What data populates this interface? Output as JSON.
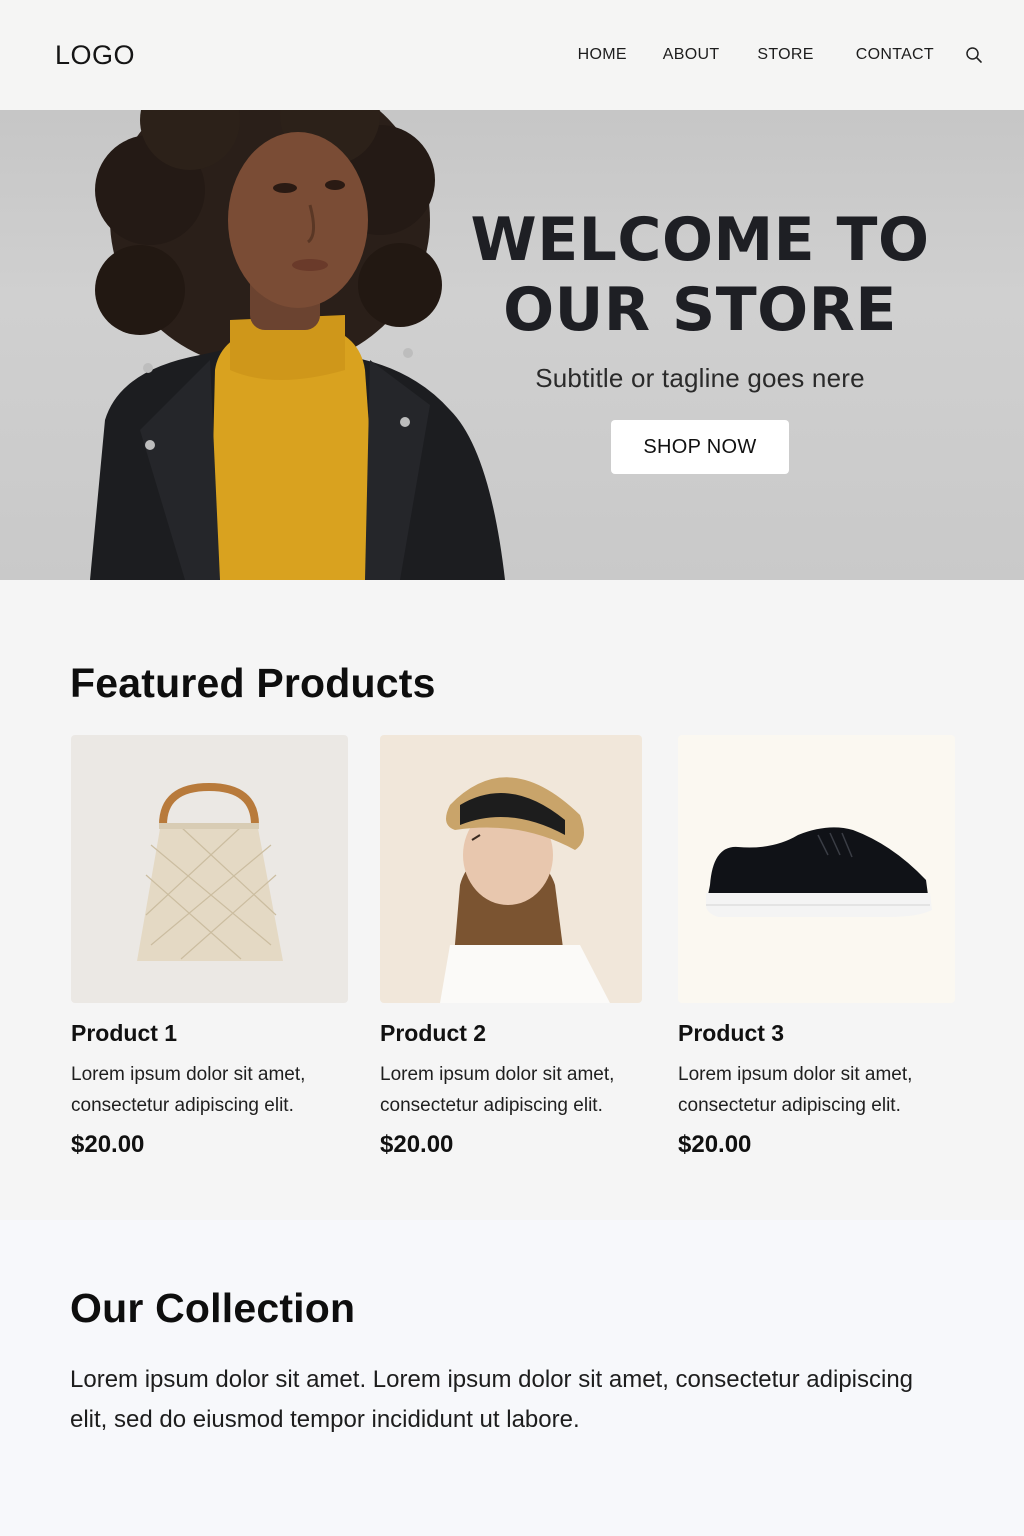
{
  "header": {
    "logo": "LOGO",
    "nav": {
      "home": "HOME",
      "about": "ABOUT",
      "store": "STORE",
      "contact": "CONTACT"
    },
    "search_icon": "search-icon"
  },
  "hero": {
    "title": "WELCOME TO\nOUR STORE",
    "subtitle": "Subtitle or tagline goes nere",
    "cta_label": "SHOP NOW"
  },
  "featured": {
    "title": "Featured Products",
    "products": [
      {
        "name": "Product 1",
        "description": "Lorem ipsum dolor sit amet, consectetur adipiscing elit.",
        "price": "$20.00",
        "image": "woven-handbag"
      },
      {
        "name": "Product 2",
        "description": "Lorem ipsum dolor sit amet, consectetur adipiscing elit.",
        "price": "$20.00",
        "image": "woman-in-straw-hat"
      },
      {
        "name": "Product 3",
        "description": "Lorem ipsum dolor sit amet, consectetur adipiscing elit.",
        "price": "$20.00",
        "image": "black-sneaker"
      }
    ]
  },
  "collection": {
    "title": "Our Collection",
    "text": "Lorem ipsum dolor sit amet.   Lorem ipsum dolor sit amet, consectetur adipiscing elit, sed do eiusmod tempor incididunt ut labore."
  },
  "colors": {
    "header_bg": "#f5f5f4",
    "hero_bg": "#c9c9c9",
    "sweater": "#d9a21f",
    "jacket": "#1c1d20",
    "text": "#121212"
  }
}
